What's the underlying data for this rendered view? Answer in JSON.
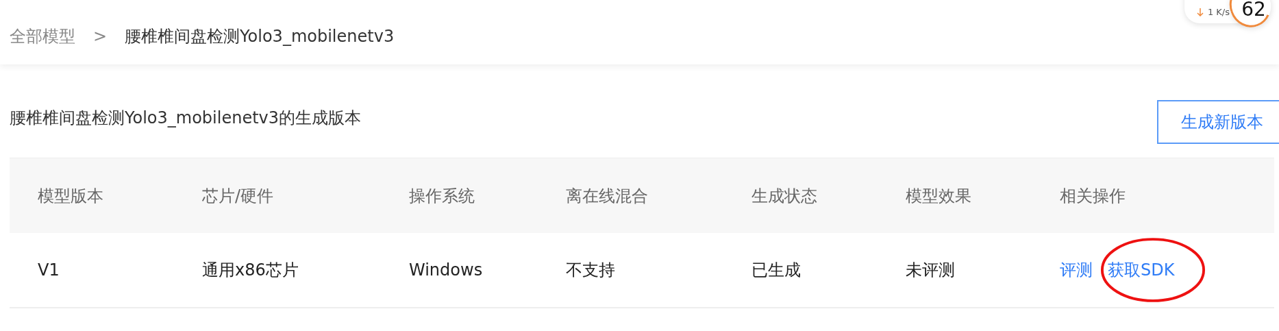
{
  "breadcrumb": {
    "parent": "全部模型",
    "separator": ">",
    "current": "腰椎椎间盘检测Yolo3_mobilenetv3"
  },
  "speed_widget": {
    "download": "1 K/s",
    "percent": "62"
  },
  "section": {
    "title": "腰椎椎间盘检测Yolo3_mobilenetv3的生成版本",
    "button": "生成新版本"
  },
  "table": {
    "columns": [
      "模型版本",
      "芯片/硬件",
      "操作系统",
      "离在线混合",
      "生成状态",
      "模型效果",
      "相关操作"
    ],
    "rows": [
      {
        "cells": [
          "V1",
          "通用x86芯片",
          "Windows",
          "不支持",
          "已生成",
          "未评测"
        ],
        "actions": [
          {
            "label": "评测",
            "circled": false
          },
          {
            "label": "获取SDK",
            "circled": true
          }
        ]
      }
    ]
  }
}
